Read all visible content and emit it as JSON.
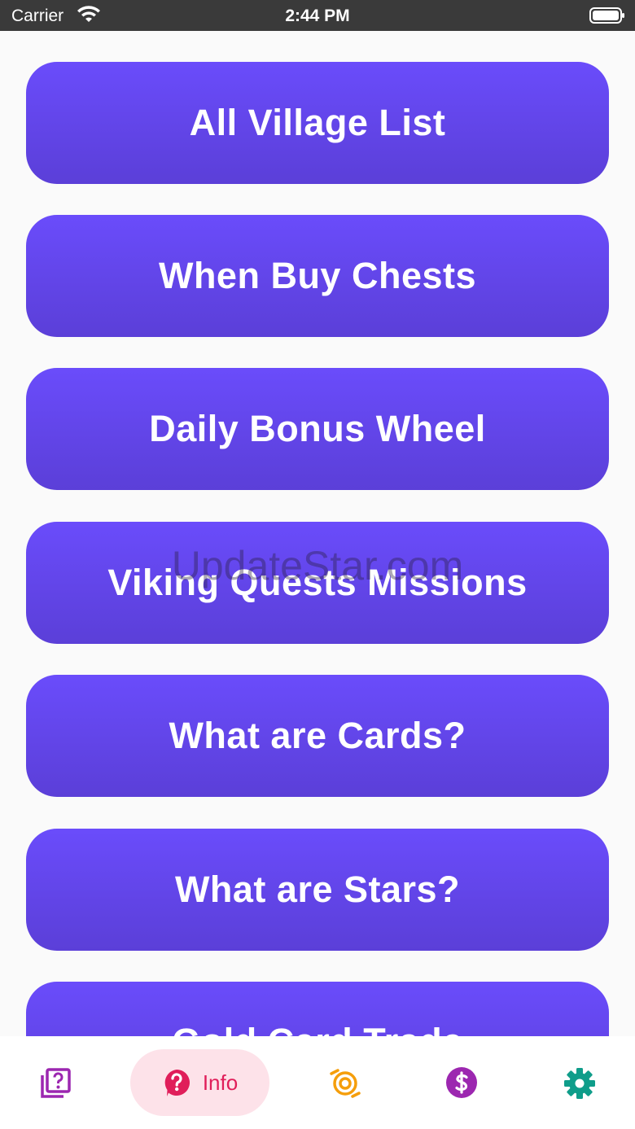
{
  "status_bar": {
    "carrier": "Carrier",
    "time": "2:44 PM"
  },
  "menu": {
    "items": [
      "All Village List",
      "When Buy Chests",
      "Daily Bonus Wheel",
      "Viking Quests Missions",
      "What are Cards?",
      "What are Stars?",
      "Gold Card Trade"
    ]
  },
  "watermark": "UpdateStar.com",
  "tab_bar": {
    "tabs": [
      {
        "icon": "question-card-icon",
        "color": "#9c27b0"
      },
      {
        "icon": "help-circle-icon",
        "label": "Info",
        "color": "#e01e5a",
        "active": true
      },
      {
        "icon": "spin-wheel-icon",
        "color": "#f59e0b"
      },
      {
        "icon": "dollar-circle-icon",
        "color": "#9c27b0"
      },
      {
        "icon": "gear-icon",
        "color": "#0f9d8a"
      }
    ]
  },
  "colors": {
    "button_top": "#6a4cfb",
    "button_bottom": "#5b3fd8",
    "background": "#fafafa"
  }
}
